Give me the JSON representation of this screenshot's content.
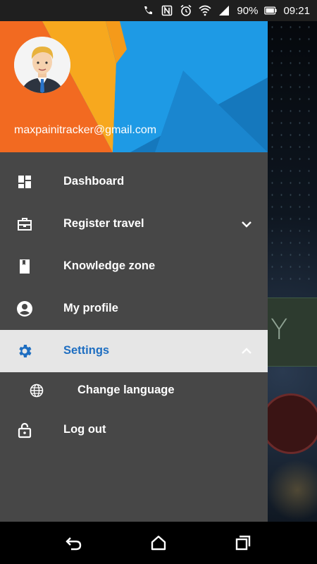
{
  "status_bar": {
    "battery": "90%",
    "time": "09:21"
  },
  "drawer": {
    "email": "maxpainitracker@gmail.com",
    "menu": [
      {
        "label": "Dashboard",
        "icon": "dashboard-icon"
      },
      {
        "label": "Register travel",
        "icon": "briefcase-icon",
        "expandable": true,
        "expanded": false
      },
      {
        "label": "Knowledge zone",
        "icon": "book-icon"
      },
      {
        "label": "My profile",
        "icon": "account-circle-icon"
      },
      {
        "label": "Settings",
        "icon": "gear-icon",
        "expandable": true,
        "expanded": true,
        "selected": true
      }
    ],
    "submenu": [
      {
        "label": "Change language",
        "icon": "globe-icon"
      }
    ],
    "logout": {
      "label": "Log out",
      "icon": "lock-open-icon"
    }
  },
  "background_app": {
    "partial_letter": "Y"
  },
  "colors": {
    "header_blue": "#1a8fd6",
    "header_orange": "#f26a21",
    "header_yellow": "#f7a81e",
    "drawer_bg": "#474747",
    "active_bg": "#e6e6e6",
    "active_accent": "#1e6ec1"
  }
}
